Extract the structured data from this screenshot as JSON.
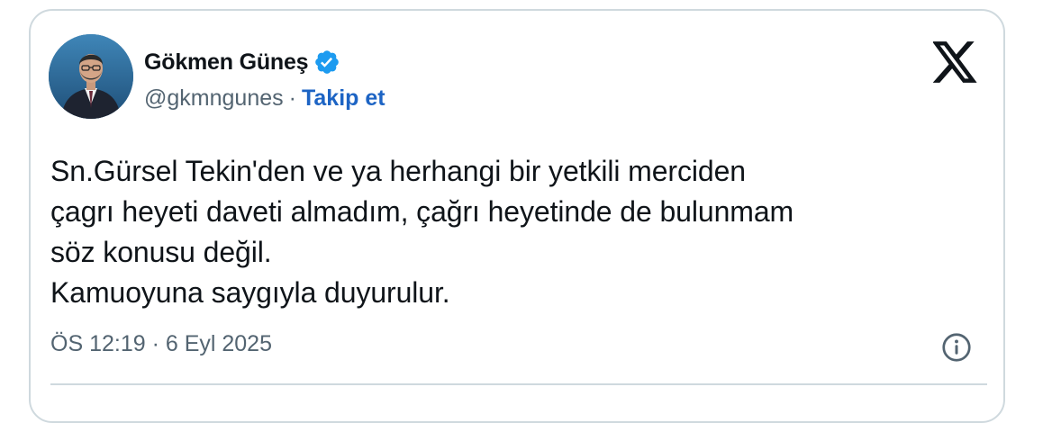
{
  "author": {
    "name": "Gökmen Güneş",
    "handle": "@gkmngunes",
    "separator": "·",
    "follow_label": "Takip et"
  },
  "icons": {
    "verified": "verified-badge-icon",
    "platform": "x-logo-icon",
    "info": "info-icon"
  },
  "colors": {
    "verified": "#1d9bf0",
    "follow": "#1d64c4",
    "text": "#0f1419",
    "muted": "#536471",
    "border": "#cfd9de"
  },
  "tweet": {
    "lines": [
      "Sn.Gürsel Tekin'den ve ya herhangi bir yetkili merciden",
      "çagrı heyeti daveti almadım, çağrı heyetinde de bulunmam",
      "söz konusu değil.",
      "Kamuoyuna saygıyla duyurulur."
    ],
    "timestamp": "ÖS 12:19 · 6 Eyl 2025"
  }
}
